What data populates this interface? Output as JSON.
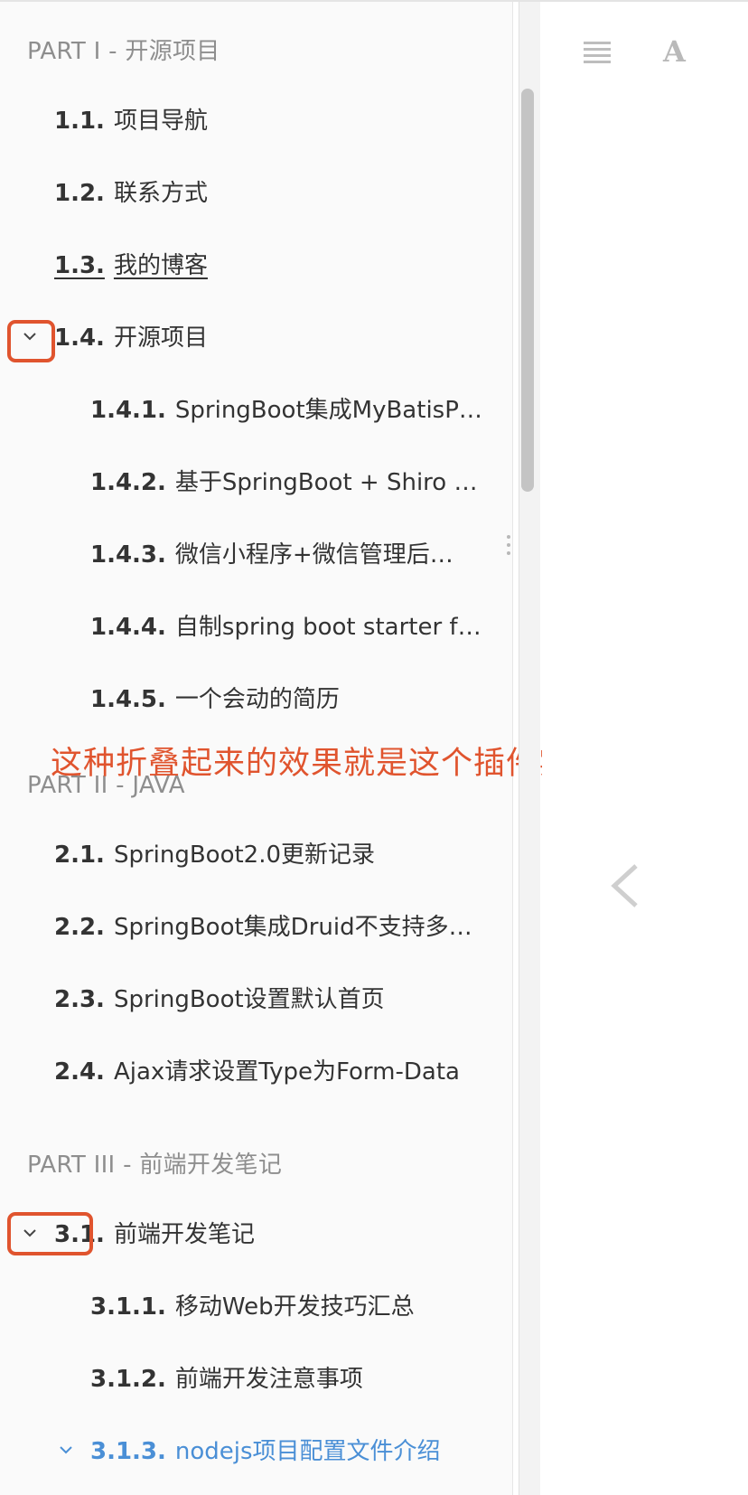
{
  "toolbar": {
    "toc_icon": "list-icon",
    "font_icon_label": "A",
    "prev_icon": "chevron-left-icon"
  },
  "sidebar": {
    "parts": [
      {
        "title": "PART I - 开源项目",
        "items": [
          {
            "num": "1.1.",
            "label": "项目导航"
          },
          {
            "num": "1.2.",
            "label": "联系方式"
          },
          {
            "num": "1.3.",
            "label": "我的博客"
          },
          {
            "num": "1.4.",
            "label": "开源项目",
            "expanded": true,
            "children": [
              {
                "num": "1.4.1.",
                "label": "SpringBoot集成MyBatisP…"
              },
              {
                "num": "1.4.2.",
                "label": "基于SpringBoot + Shiro +…"
              },
              {
                "num": "1.4.3.",
                "label": "微信小程序+微信管理后…"
              },
              {
                "num": "1.4.4.",
                "label": "自制spring boot starter fo…"
              },
              {
                "num": "1.4.5.",
                "label": "一个会动的简历"
              }
            ]
          }
        ]
      },
      {
        "title": "PART II - JAVA",
        "items": [
          {
            "num": "2.1.",
            "label": "SpringBoot2.0更新记录"
          },
          {
            "num": "2.2.",
            "label": "SpringBoot集成Druid不支持多…"
          },
          {
            "num": "2.3.",
            "label": "SpringBoot设置默认首页"
          },
          {
            "num": "2.4.",
            "label": "Ajax请求设置Type为Form-Data"
          }
        ]
      },
      {
        "title": "PART III - 前端开发笔记",
        "items": [
          {
            "num": "3.1.",
            "label": "前端开发笔记",
            "expanded": true,
            "children": [
              {
                "num": "3.1.1.",
                "label": "移动Web开发技巧汇总"
              },
              {
                "num": "3.1.2.",
                "label": "前端开发注意事项"
              },
              {
                "num": "3.1.3.",
                "label": "nodejs项目配置文件介绍",
                "active": true
              }
            ]
          }
        ]
      }
    ]
  },
  "annotation": {
    "text": "这种折叠起来的效果就是这个插件实现的。",
    "color": "#e0542e"
  },
  "colors": {
    "active_link": "#4a8fd6",
    "highlight": "#e0542e",
    "part_header": "#8e8e8e"
  }
}
